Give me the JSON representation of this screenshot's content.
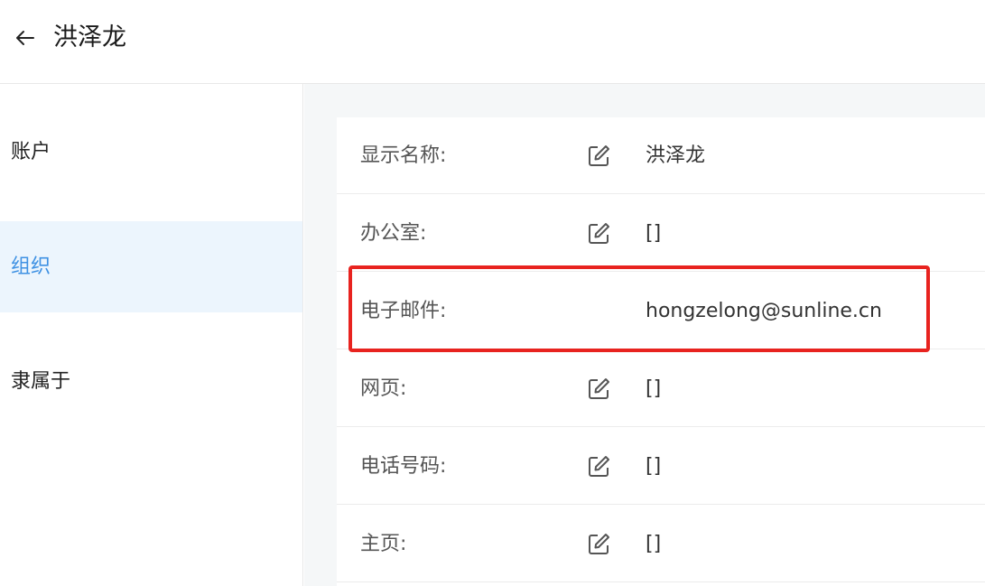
{
  "header": {
    "title": "洪泽龙"
  },
  "sidebar": {
    "items": [
      {
        "label": "账户"
      },
      {
        "label": "组织"
      },
      {
        "label": "隶属于"
      }
    ]
  },
  "fields": [
    {
      "label": "显示名称:",
      "value": "洪泽龙",
      "editable": true
    },
    {
      "label": "办公室:",
      "value": "[]",
      "editable": true
    },
    {
      "label": "电子邮件:",
      "value": "hongzelong@sunline.cn",
      "editable": false
    },
    {
      "label": "网页:",
      "value": "[]",
      "editable": true
    },
    {
      "label": "电话号码:",
      "value": "[]",
      "editable": true
    },
    {
      "label": "主页:",
      "value": "[]",
      "editable": true
    }
  ],
  "colors": {
    "accent": "#3e91e3",
    "active_bg": "#ecf5fd",
    "highlight": "#e8231f",
    "content_bg": "#f5f7f8"
  },
  "icons": {
    "back": "arrow-left-icon",
    "edit": "edit-icon"
  }
}
